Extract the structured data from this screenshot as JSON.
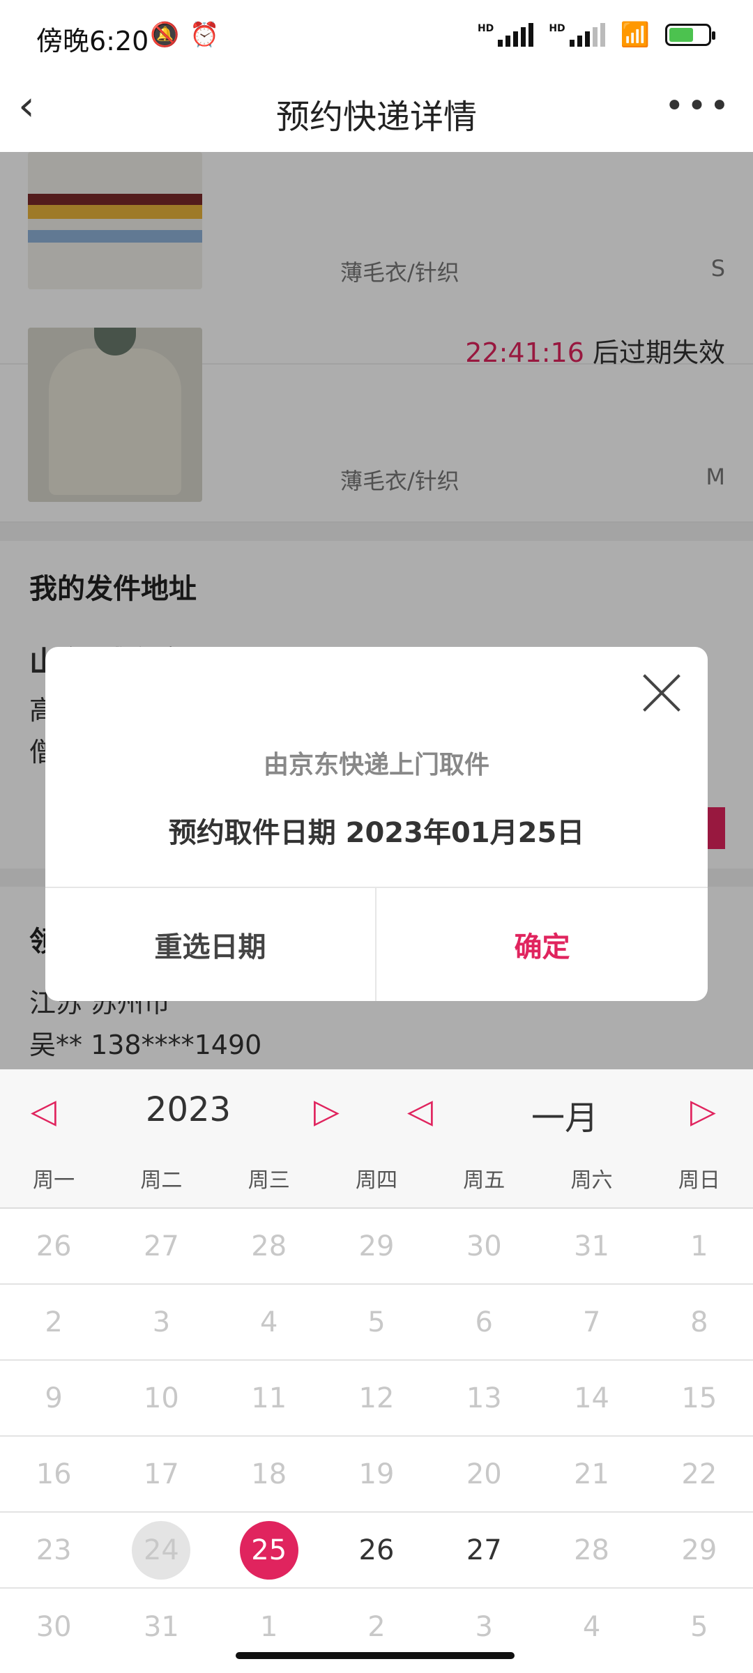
{
  "status_bar": {
    "time": "傍晚6:20",
    "icons": [
      "mute-icon",
      "alarm-icon",
      "signal-icon",
      "signal-icon",
      "wifi-icon",
      "battery-charging-icon"
    ],
    "hd_label": "HD"
  },
  "header": {
    "title": "预约快递详情",
    "back_icon": "‹",
    "more_icon": "•••"
  },
  "items": [
    {
      "category": "薄毛衣/针织",
      "size": "S"
    },
    {
      "category": "薄毛衣/针织",
      "size": "M",
      "timer": "22:41:16",
      "expire_text": " 后过期失效"
    }
  ],
  "sender_address": {
    "title": "我的发件地址",
    "line1": "山东 威海市 环翠区",
    "line2": "高",
    "line3": "僧"
  },
  "receiver": {
    "title": "领",
    "city": "江苏 苏州市",
    "contact": "吴** 138****1490"
  },
  "dialog": {
    "subtitle": "由京东快递上门取件",
    "date_text": "预约取件日期 2023年01月25日",
    "reselect_label": "重选日期",
    "confirm_label": "确定"
  },
  "calendar": {
    "year": "2023",
    "month": "一月",
    "prev_icon": "◁",
    "next_icon": "▷",
    "weekdays": [
      "周一",
      "周二",
      "周三",
      "周四",
      "周五",
      "周六",
      "周日"
    ],
    "weeks": [
      [
        "26",
        "27",
        "28",
        "29",
        "30",
        "31",
        "1"
      ],
      [
        "2",
        "3",
        "4",
        "5",
        "6",
        "7",
        "8"
      ],
      [
        "9",
        "10",
        "11",
        "12",
        "13",
        "14",
        "15"
      ],
      [
        "16",
        "17",
        "18",
        "19",
        "20",
        "21",
        "22"
      ],
      [
        "23",
        "24",
        "25",
        "26",
        "27",
        "28",
        "29"
      ],
      [
        "30",
        "31",
        "1",
        "2",
        "3",
        "4",
        "5"
      ]
    ],
    "today": "24",
    "selected": "25",
    "available": [
      "26",
      "27"
    ]
  },
  "colors": {
    "accent": "#e0245e",
    "overlay": "rgba(0,0,0,0.32)"
  }
}
